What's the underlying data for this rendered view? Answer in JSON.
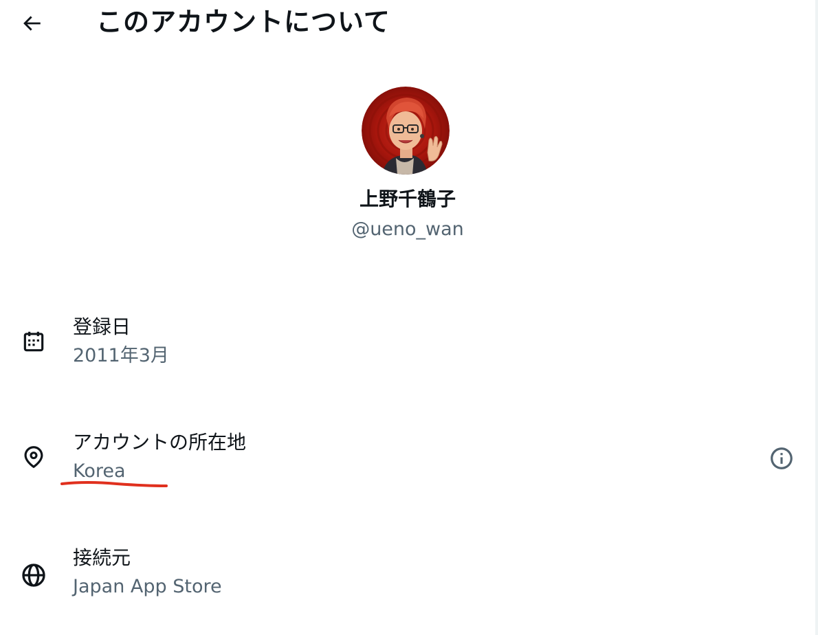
{
  "header": {
    "back_icon": "arrow-left-icon",
    "title": "このアカウントについて"
  },
  "profile": {
    "avatar_icon": "avatar-icon",
    "display_name": "上野千鶴子",
    "handle": "@ueno_wan"
  },
  "rows": [
    {
      "icon": "calendar-icon",
      "label": "登録日",
      "value": "2011年3月"
    },
    {
      "icon": "location-pin-icon",
      "label": "アカウントの所在地",
      "value": "Korea",
      "info_icon": "info-icon"
    },
    {
      "icon": "globe-icon",
      "label": "接続元",
      "value": "Japan App Store"
    }
  ],
  "colors": {
    "text_primary": "#0f1419",
    "text_secondary": "#536471",
    "annotation_red": "#e0301e",
    "avatar_bg": "#b3170f"
  }
}
